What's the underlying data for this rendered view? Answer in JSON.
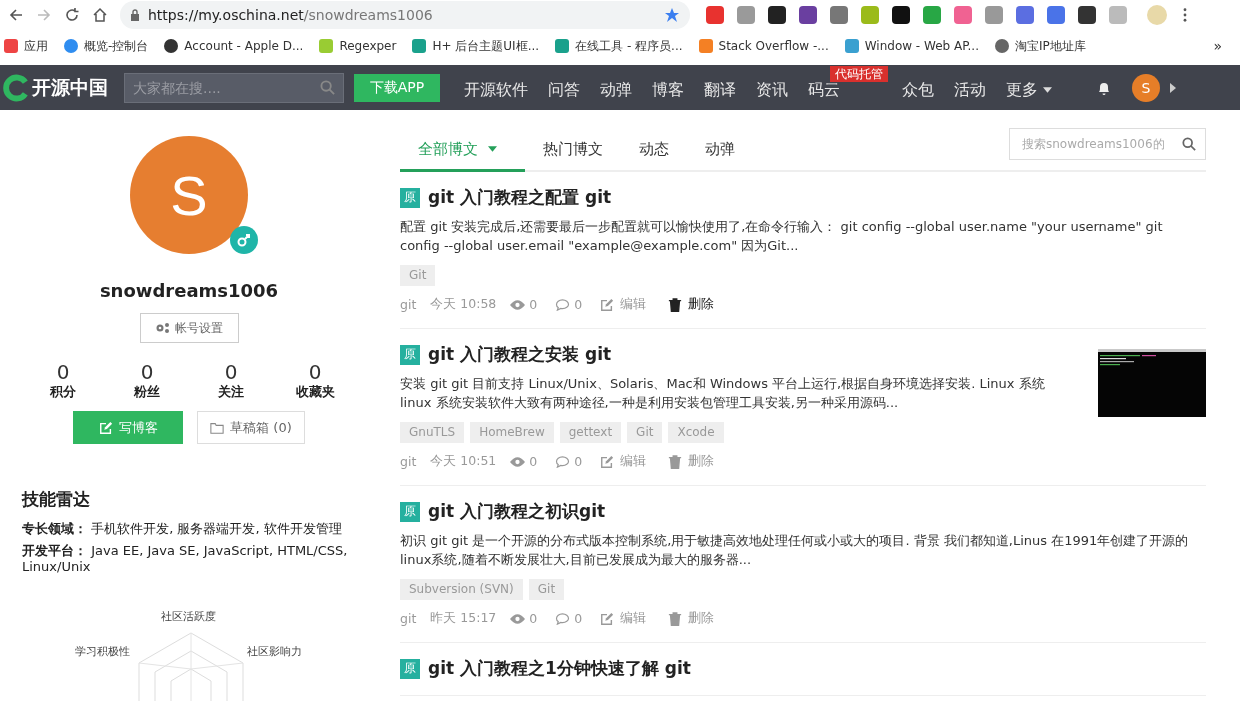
{
  "browser": {
    "url_host": "https://my.oschina.net",
    "url_path": "/snowdreams1006",
    "bookmarks": [
      {
        "label": "应用"
      },
      {
        "label": "概览-控制台"
      },
      {
        "label": "Account - Apple D..."
      },
      {
        "label": "Regexper"
      },
      {
        "label": "H+ 后台主题UI框..."
      },
      {
        "label": "在线工具 - 程序员..."
      },
      {
        "label": "Stack Overflow -..."
      },
      {
        "label": "Window - Web AP..."
      },
      {
        "label": "淘宝IP地址库"
      }
    ],
    "more": "»"
  },
  "nav": {
    "logo": "开源中国",
    "search_placeholder": "大家都在搜....",
    "download": "下载APP",
    "items": [
      {
        "label": "开源软件"
      },
      {
        "label": "问答"
      },
      {
        "label": "动弹"
      },
      {
        "label": "博客"
      },
      {
        "label": "翻译"
      },
      {
        "label": "资讯"
      },
      {
        "label": "码云",
        "badge": "代码托管"
      },
      {
        "label": "众包"
      },
      {
        "label": "活动"
      },
      {
        "label": "更多",
        "dropdown": true
      }
    ],
    "avatar": "S"
  },
  "profile": {
    "avatar": "S",
    "name": "snowdreams1006",
    "settings": "帐号设置",
    "stats": [
      {
        "value": "0",
        "label": "积分"
      },
      {
        "value": "0",
        "label": "粉丝"
      },
      {
        "value": "0",
        "label": "关注"
      },
      {
        "value": "0",
        "label": "收藏夹"
      }
    ],
    "write": "写博客",
    "drafts": "草稿箱 (0)"
  },
  "skills": {
    "title": "技能雷达",
    "rows": [
      {
        "label": "专长领域：",
        "value": "手机软件开发, 服务器端开发, 软件开发管理"
      },
      {
        "label": "开发平台：",
        "value": "Java EE, Java SE, JavaScript, HTML/CSS, Linux/Unix"
      }
    ],
    "radar_labels": [
      "社区活跃度",
      "社区影响力",
      "学习积极性"
    ]
  },
  "tabs": [
    {
      "label": "全部博文",
      "selected": true,
      "dropdown": true
    },
    {
      "label": "热门博文",
      "selected": false
    },
    {
      "label": "动态",
      "selected": false
    },
    {
      "label": "动弹",
      "selected": false
    }
  ],
  "blog_search_placeholder": "搜索snowdreams1006的",
  "posts": [
    {
      "badge": "原",
      "title": "git 入门教程之配置 git",
      "summary": "配置 git 安装完成后,还需要最后一步配置就可以愉快使用了,在命令行输入： git config --global user.name \"your username\" git config --global user.email \"example@example.com\" 因为Git...",
      "thumbnail": false,
      "tags": [
        "Git"
      ],
      "category": "git",
      "time": "今天 10:58",
      "views": "0",
      "comments": "0",
      "edit": "编辑",
      "delete": "删除",
      "hover": true
    },
    {
      "badge": "原",
      "title": "git 入门教程之安装 git",
      "summary": "安装 git git 目前支持 Linux/Unix、Solaris、Mac和 Windows 平台上运行,根据自身环境选择安装. Linux 系统 linux 系统安装软件大致有两种途径,一种是利用安装包管理工具安装,另一种采用源码...",
      "thumbnail": true,
      "tags": [
        "GnuTLS",
        "HomeBrew",
        "gettext",
        "Git",
        "Xcode"
      ],
      "category": "git",
      "time": "今天 10:51",
      "views": "0",
      "comments": "0",
      "edit": "编辑",
      "delete": "删除",
      "hover": false
    },
    {
      "badge": "原",
      "title": "git 入门教程之初识git",
      "summary": "初识 git git 是一个开源的分布式版本控制系统,用于敏捷高效地处理任何或小或大的项目. 背景 我们都知道,Linus 在1991年创建了开源的linux系统,随着不断发展壮大,目前已发展成为最大的服务器...",
      "thumbnail": false,
      "tags": [
        "Subversion (SVN)",
        "Git"
      ],
      "category": "git",
      "time": "昨天 15:17",
      "views": "0",
      "comments": "0",
      "edit": "编辑",
      "delete": "删除",
      "hover": false
    },
    {
      "badge": "原",
      "title": "git 入门教程之1分钟快速了解 git"
    }
  ]
}
